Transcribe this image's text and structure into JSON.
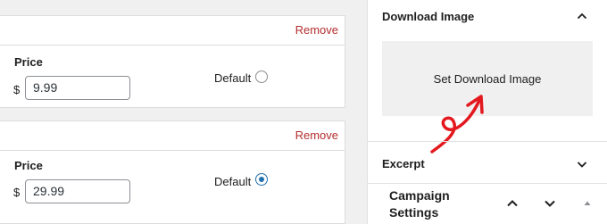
{
  "prices": [
    {
      "remove_label": "Remove",
      "price_label": "Price",
      "currency": "$",
      "amount": "9.99",
      "default_label": "Default",
      "is_default": false
    },
    {
      "remove_label": "Remove",
      "price_label": "Price",
      "currency": "$",
      "amount": "29.99",
      "default_label": "Default",
      "is_default": true
    }
  ],
  "sidebar": {
    "download_image": {
      "title": "Download Image",
      "toggle_icon": "chevron-up-icon",
      "button_label": "Set Download Image"
    },
    "excerpt": {
      "title": "Excerpt",
      "toggle_icon": "chevron-down-icon"
    },
    "campaign_settings": {
      "title": "Campaign Settings",
      "icons": [
        "chevron-up-icon",
        "chevron-down-icon",
        "triangle-up-icon"
      ]
    }
  },
  "colors": {
    "remove": "#b32d2e",
    "radio_checked": "#2271b1",
    "annotation_arrow": "#e3191f"
  }
}
